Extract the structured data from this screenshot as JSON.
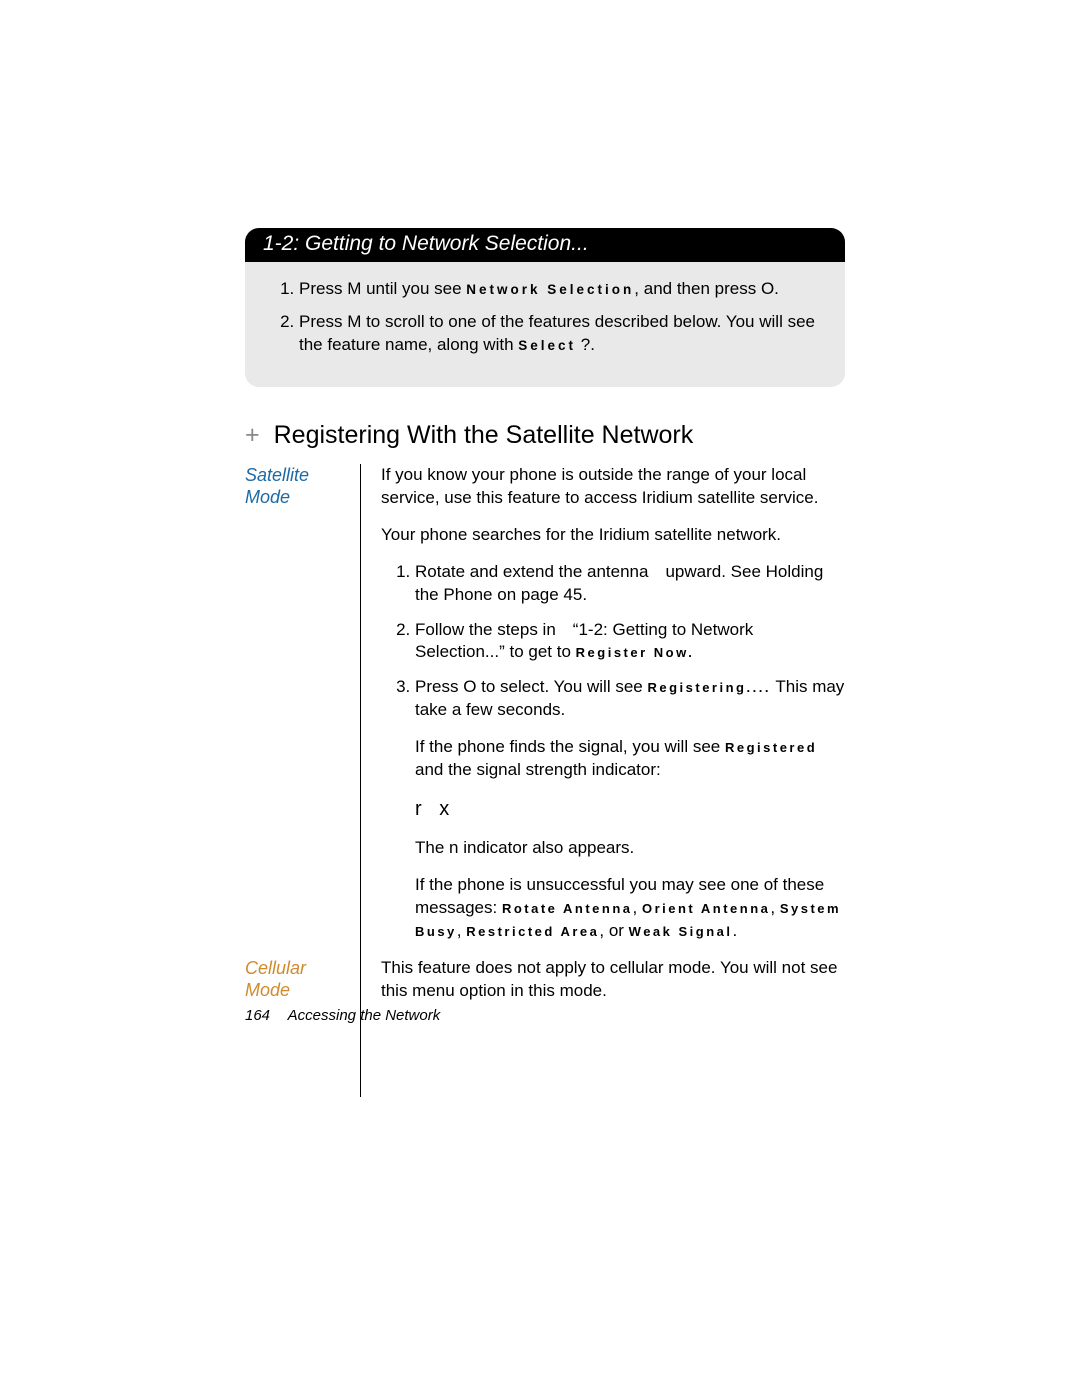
{
  "bar": {
    "num": "1-2:",
    "title": "Getting to Network Selection..."
  },
  "grey": {
    "step1_a": "Press ",
    "step1_key1": "M",
    "step1_b": " until you see ",
    "step1_disp": "Network Selection",
    "step1_c": ", and then press ",
    "step1_key2": "O",
    "step1_d": ".",
    "step2_a": "Press ",
    "step2_key": "M",
    "step2_b": " to scroll to one of the features described below. You will see the feature name, along with ",
    "step2_disp": "Select",
    "step2_c": " ?."
  },
  "h2_plus": "+",
  "h2_text": "Registering With the Satellite Network",
  "satLabel1": "Satellite",
  "satLabel2": "Mode",
  "sat": {
    "p1": "If you know your phone is outside the range of your local service, use this feature to access Iridium satellite service.",
    "p2": "Your phone searches for the Iridium satellite network.",
    "li1": "Rotate and extend the antenna upward. See Holding the Phone on page 45.",
    "li2_a": "Follow the steps in “1-2: Getting to Network Selection...” to get to ",
    "li2_disp": "Register Now.",
    "li3_a": "Press ",
    "li3_key": "O",
    "li3_b": " to select. You will see ",
    "li3_disp": "Registering....",
    "li3_c": " This may take a few seconds.",
    "p3_a": "If the phone ﬁnds the signal, you will see ",
    "p3_disp": "Registered",
    "p3_b": " and the signal strength indicator:",
    "sig": "r x",
    "p4_a": "The ",
    "p4_ind": "n",
    "p4_b": " indicator also appears.",
    "p5_a": "If the phone is unsuccessful you may see one of these messages: ",
    "p5_d1": "Rotate Antenna",
    "p5_s1": ", ",
    "p5_d2": "Orient Antenna",
    "p5_s2": ", ",
    "p5_d3": "System Busy",
    "p5_s3": ", ",
    "p5_d4": "Restricted Area",
    "p5_s4": ", or ",
    "p5_d5": "Weak Signal",
    "p5_end": "."
  },
  "cellLabel1": "Cellular",
  "cellLabel2": "Mode",
  "cellBody": "This feature does not apply to cellular mode. You will not see this menu option in this mode.",
  "footer": {
    "page": "164",
    "title": "Accessing the Network"
  }
}
